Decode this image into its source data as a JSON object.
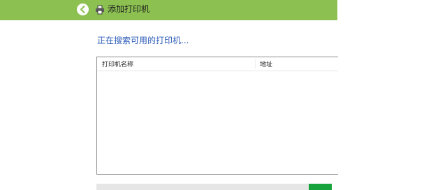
{
  "window": {
    "title": "添加打印机",
    "title_bar_color": "#8cc152"
  },
  "icons": {
    "back": "back-arrow-icon",
    "printer": "printer-icon"
  },
  "content": {
    "status": "正在搜索可用的打印机..."
  },
  "printer_list": {
    "columns": [
      "打印机名称",
      "地址"
    ],
    "rows": []
  },
  "progress": {
    "indeterminate": true,
    "color": "#16a33b"
  }
}
